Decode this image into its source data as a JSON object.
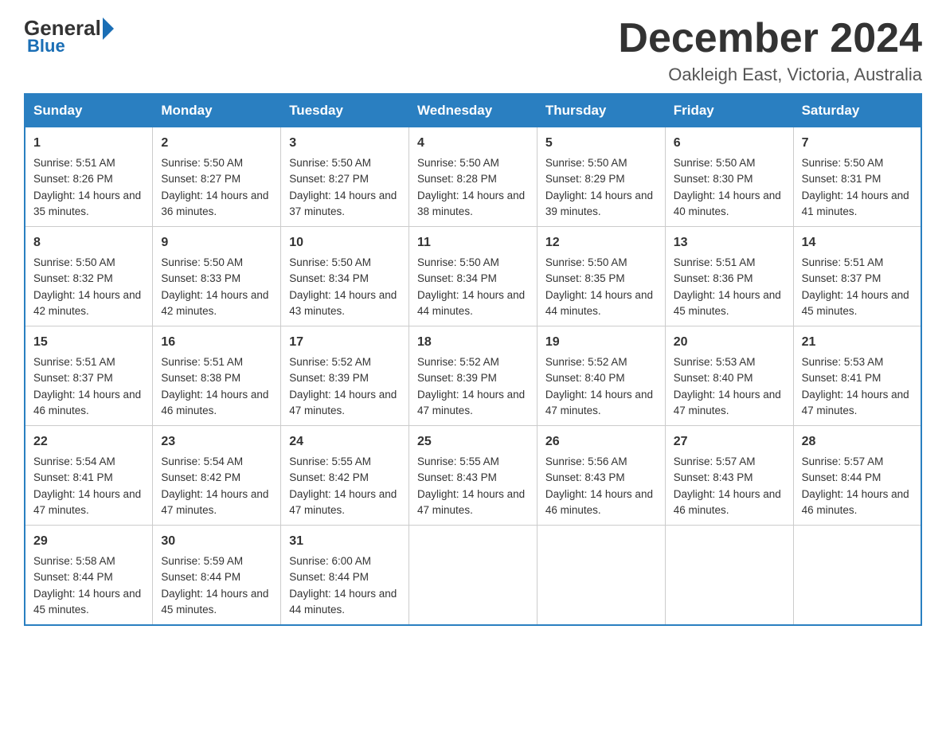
{
  "logo": {
    "general": "General",
    "triangle": "",
    "blue": "Blue"
  },
  "header": {
    "title": "December 2024",
    "subtitle": "Oakleigh East, Victoria, Australia"
  },
  "days": [
    "Sunday",
    "Monday",
    "Tuesday",
    "Wednesday",
    "Thursday",
    "Friday",
    "Saturday"
  ],
  "weeks": [
    [
      {
        "num": "1",
        "sunrise": "5:51 AM",
        "sunset": "8:26 PM",
        "daylight": "14 hours and 35 minutes."
      },
      {
        "num": "2",
        "sunrise": "5:50 AM",
        "sunset": "8:27 PM",
        "daylight": "14 hours and 36 minutes."
      },
      {
        "num": "3",
        "sunrise": "5:50 AM",
        "sunset": "8:27 PM",
        "daylight": "14 hours and 37 minutes."
      },
      {
        "num": "4",
        "sunrise": "5:50 AM",
        "sunset": "8:28 PM",
        "daylight": "14 hours and 38 minutes."
      },
      {
        "num": "5",
        "sunrise": "5:50 AM",
        "sunset": "8:29 PM",
        "daylight": "14 hours and 39 minutes."
      },
      {
        "num": "6",
        "sunrise": "5:50 AM",
        "sunset": "8:30 PM",
        "daylight": "14 hours and 40 minutes."
      },
      {
        "num": "7",
        "sunrise": "5:50 AM",
        "sunset": "8:31 PM",
        "daylight": "14 hours and 41 minutes."
      }
    ],
    [
      {
        "num": "8",
        "sunrise": "5:50 AM",
        "sunset": "8:32 PM",
        "daylight": "14 hours and 42 minutes."
      },
      {
        "num": "9",
        "sunrise": "5:50 AM",
        "sunset": "8:33 PM",
        "daylight": "14 hours and 42 minutes."
      },
      {
        "num": "10",
        "sunrise": "5:50 AM",
        "sunset": "8:34 PM",
        "daylight": "14 hours and 43 minutes."
      },
      {
        "num": "11",
        "sunrise": "5:50 AM",
        "sunset": "8:34 PM",
        "daylight": "14 hours and 44 minutes."
      },
      {
        "num": "12",
        "sunrise": "5:50 AM",
        "sunset": "8:35 PM",
        "daylight": "14 hours and 44 minutes."
      },
      {
        "num": "13",
        "sunrise": "5:51 AM",
        "sunset": "8:36 PM",
        "daylight": "14 hours and 45 minutes."
      },
      {
        "num": "14",
        "sunrise": "5:51 AM",
        "sunset": "8:37 PM",
        "daylight": "14 hours and 45 minutes."
      }
    ],
    [
      {
        "num": "15",
        "sunrise": "5:51 AM",
        "sunset": "8:37 PM",
        "daylight": "14 hours and 46 minutes."
      },
      {
        "num": "16",
        "sunrise": "5:51 AM",
        "sunset": "8:38 PM",
        "daylight": "14 hours and 46 minutes."
      },
      {
        "num": "17",
        "sunrise": "5:52 AM",
        "sunset": "8:39 PM",
        "daylight": "14 hours and 47 minutes."
      },
      {
        "num": "18",
        "sunrise": "5:52 AM",
        "sunset": "8:39 PM",
        "daylight": "14 hours and 47 minutes."
      },
      {
        "num": "19",
        "sunrise": "5:52 AM",
        "sunset": "8:40 PM",
        "daylight": "14 hours and 47 minutes."
      },
      {
        "num": "20",
        "sunrise": "5:53 AM",
        "sunset": "8:40 PM",
        "daylight": "14 hours and 47 minutes."
      },
      {
        "num": "21",
        "sunrise": "5:53 AM",
        "sunset": "8:41 PM",
        "daylight": "14 hours and 47 minutes."
      }
    ],
    [
      {
        "num": "22",
        "sunrise": "5:54 AM",
        "sunset": "8:41 PM",
        "daylight": "14 hours and 47 minutes."
      },
      {
        "num": "23",
        "sunrise": "5:54 AM",
        "sunset": "8:42 PM",
        "daylight": "14 hours and 47 minutes."
      },
      {
        "num": "24",
        "sunrise": "5:55 AM",
        "sunset": "8:42 PM",
        "daylight": "14 hours and 47 minutes."
      },
      {
        "num": "25",
        "sunrise": "5:55 AM",
        "sunset": "8:43 PM",
        "daylight": "14 hours and 47 minutes."
      },
      {
        "num": "26",
        "sunrise": "5:56 AM",
        "sunset": "8:43 PM",
        "daylight": "14 hours and 46 minutes."
      },
      {
        "num": "27",
        "sunrise": "5:57 AM",
        "sunset": "8:43 PM",
        "daylight": "14 hours and 46 minutes."
      },
      {
        "num": "28",
        "sunrise": "5:57 AM",
        "sunset": "8:44 PM",
        "daylight": "14 hours and 46 minutes."
      }
    ],
    [
      {
        "num": "29",
        "sunrise": "5:58 AM",
        "sunset": "8:44 PM",
        "daylight": "14 hours and 45 minutes."
      },
      {
        "num": "30",
        "sunrise": "5:59 AM",
        "sunset": "8:44 PM",
        "daylight": "14 hours and 45 minutes."
      },
      {
        "num": "31",
        "sunrise": "6:00 AM",
        "sunset": "8:44 PM",
        "daylight": "14 hours and 44 minutes."
      },
      null,
      null,
      null,
      null
    ]
  ]
}
